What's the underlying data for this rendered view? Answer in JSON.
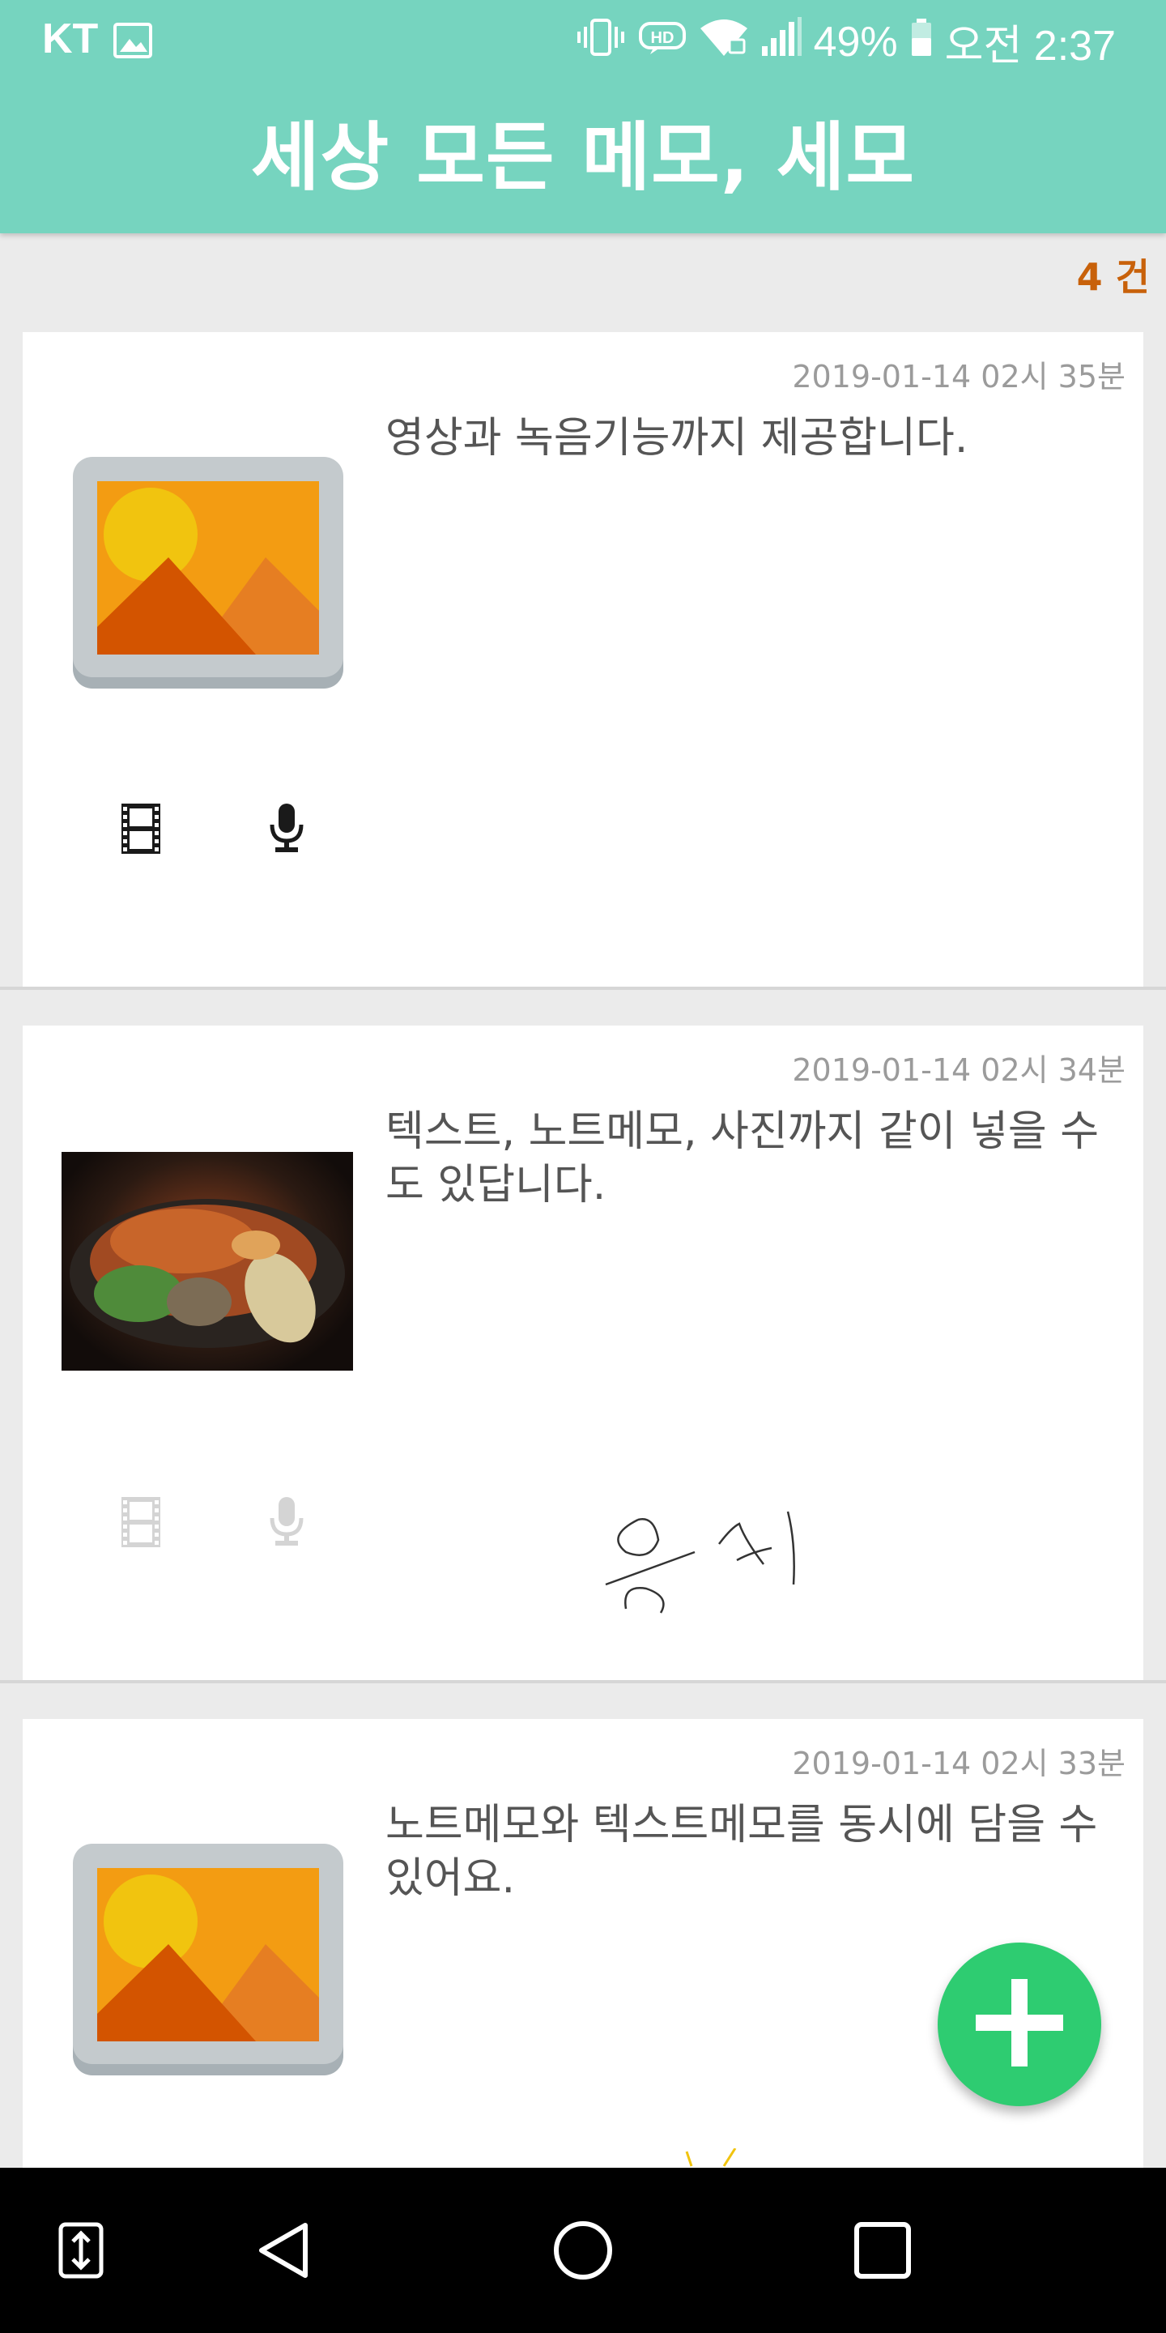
{
  "status_bar": {
    "carrier": "KT",
    "battery": "49%",
    "time": "오전 2:37"
  },
  "app_bar": {
    "title": "세상 모든 메모, 세모"
  },
  "memo_count": "4 건",
  "memos": [
    {
      "date": "2019-01-14 02시 35분",
      "text": "영상과 녹음기능까지 제공합니다.",
      "thumbnail": "image-placeholder-icon",
      "video_icon": "film-icon",
      "audio_icon": "microphone-icon",
      "media_active": true
    },
    {
      "date": "2019-01-14 02시 34분",
      "text": "텍스트, 노트메모, 사진까지 같이 넣을 수도 있답니다.",
      "thumbnail": "food-photo",
      "video_icon": "film-icon",
      "audio_icon": "microphone-icon",
      "media_active": false,
      "handwriting": "음식"
    },
    {
      "date": "2019-01-14 02시 33분",
      "text": "노트메모와 텍스트메모를 동시에 담을 수 있어요.",
      "thumbnail": "image-placeholder-icon"
    }
  ],
  "fab": {
    "icon": "plus-icon"
  },
  "nav_bar": {
    "buttons": [
      "dual-window-icon",
      "back-icon",
      "home-icon",
      "recents-icon"
    ]
  },
  "colors": {
    "app_bar": "#76d4bf",
    "count_text": "#c8610a",
    "fab": "#2ecc71",
    "background": "#ebebeb"
  }
}
